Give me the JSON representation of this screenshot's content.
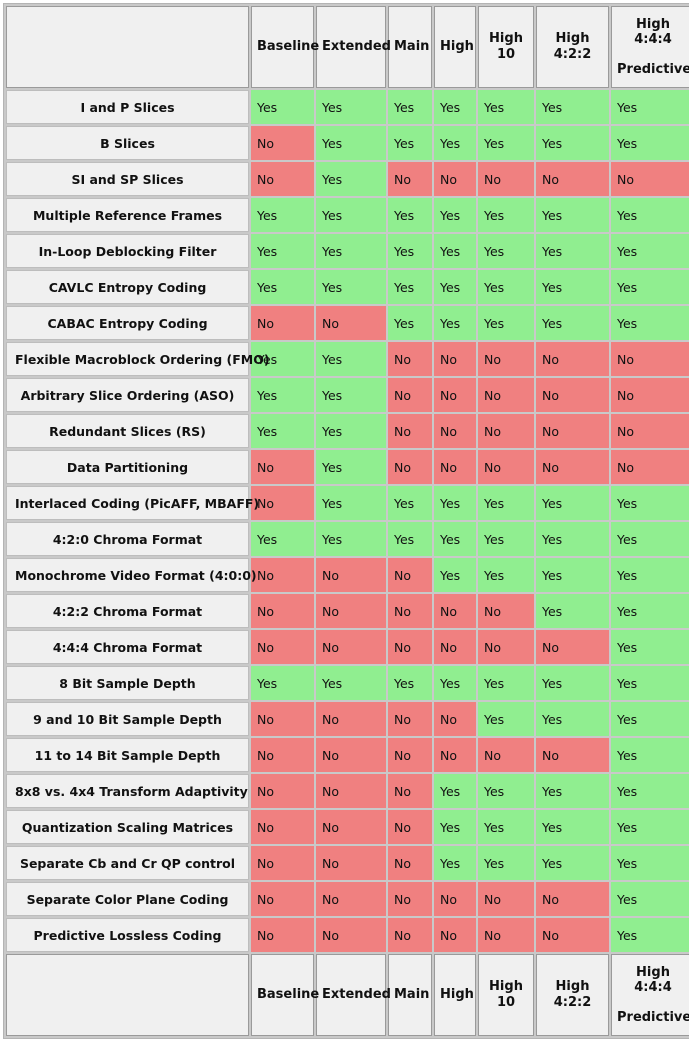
{
  "table": {
    "feature_column_header": "",
    "profiles": [
      {
        "id": "baseline",
        "label": "Baseline",
        "label_line2": ""
      },
      {
        "id": "extended",
        "label": "Extended",
        "label_line2": ""
      },
      {
        "id": "main",
        "label": "Main",
        "label_line2": ""
      },
      {
        "id": "high",
        "label": "High",
        "label_line2": ""
      },
      {
        "id": "high10",
        "label": "High 10",
        "label_line2": ""
      },
      {
        "id": "high422",
        "label": "High 4:2:2",
        "label_line2": ""
      },
      {
        "id": "high444",
        "label": "High 4:4:4",
        "label_line2": "Predictive"
      }
    ],
    "value_yes": "Yes",
    "value_no": "No",
    "colors": {
      "yes_background": "#90EE90",
      "no_background": "#F08080",
      "header_background": "#F0F0F0",
      "feature_background": "#F0F0F0",
      "grid_line": "#C9C9C9",
      "text": "#111111"
    },
    "rows": [
      {
        "feature": "I and P Slices",
        "values": [
          "Yes",
          "Yes",
          "Yes",
          "Yes",
          "Yes",
          "Yes",
          "Yes"
        ]
      },
      {
        "feature": "B Slices",
        "values": [
          "No",
          "Yes",
          "Yes",
          "Yes",
          "Yes",
          "Yes",
          "Yes"
        ]
      },
      {
        "feature": "SI and SP Slices",
        "values": [
          "No",
          "Yes",
          "No",
          "No",
          "No",
          "No",
          "No"
        ]
      },
      {
        "feature": "Multiple Reference Frames",
        "values": [
          "Yes",
          "Yes",
          "Yes",
          "Yes",
          "Yes",
          "Yes",
          "Yes"
        ]
      },
      {
        "feature": "In-Loop Deblocking Filter",
        "values": [
          "Yes",
          "Yes",
          "Yes",
          "Yes",
          "Yes",
          "Yes",
          "Yes"
        ]
      },
      {
        "feature": "CAVLC Entropy Coding",
        "values": [
          "Yes",
          "Yes",
          "Yes",
          "Yes",
          "Yes",
          "Yes",
          "Yes"
        ]
      },
      {
        "feature": "CABAC Entropy Coding",
        "values": [
          "No",
          "No",
          "Yes",
          "Yes",
          "Yes",
          "Yes",
          "Yes"
        ]
      },
      {
        "feature": "Flexible Macroblock Ordering (FMO)",
        "values": [
          "Yes",
          "Yes",
          "No",
          "No",
          "No",
          "No",
          "No"
        ]
      },
      {
        "feature": "Arbitrary Slice Ordering (ASO)",
        "values": [
          "Yes",
          "Yes",
          "No",
          "No",
          "No",
          "No",
          "No"
        ]
      },
      {
        "feature": "Redundant Slices (RS)",
        "values": [
          "Yes",
          "Yes",
          "No",
          "No",
          "No",
          "No",
          "No"
        ]
      },
      {
        "feature": "Data Partitioning",
        "values": [
          "No",
          "Yes",
          "No",
          "No",
          "No",
          "No",
          "No"
        ]
      },
      {
        "feature": "Interlaced Coding (PicAFF, MBAFF)",
        "values": [
          "No",
          "Yes",
          "Yes",
          "Yes",
          "Yes",
          "Yes",
          "Yes"
        ]
      },
      {
        "feature": "4:2:0 Chroma Format",
        "values": [
          "Yes",
          "Yes",
          "Yes",
          "Yes",
          "Yes",
          "Yes",
          "Yes"
        ]
      },
      {
        "feature": "Monochrome Video Format (4:0:0)",
        "values": [
          "No",
          "No",
          "No",
          "Yes",
          "Yes",
          "Yes",
          "Yes"
        ]
      },
      {
        "feature": "4:2:2 Chroma Format",
        "values": [
          "No",
          "No",
          "No",
          "No",
          "No",
          "Yes",
          "Yes"
        ]
      },
      {
        "feature": "4:4:4 Chroma Format",
        "values": [
          "No",
          "No",
          "No",
          "No",
          "No",
          "No",
          "Yes"
        ]
      },
      {
        "feature": "8 Bit Sample Depth",
        "values": [
          "Yes",
          "Yes",
          "Yes",
          "Yes",
          "Yes",
          "Yes",
          "Yes"
        ]
      },
      {
        "feature": "9 and 10 Bit Sample Depth",
        "values": [
          "No",
          "No",
          "No",
          "No",
          "Yes",
          "Yes",
          "Yes"
        ]
      },
      {
        "feature": "11 to 14 Bit Sample Depth",
        "values": [
          "No",
          "No",
          "No",
          "No",
          "No",
          "No",
          "Yes"
        ]
      },
      {
        "feature": "8x8 vs. 4x4 Transform Adaptivity",
        "values": [
          "No",
          "No",
          "No",
          "Yes",
          "Yes",
          "Yes",
          "Yes"
        ]
      },
      {
        "feature": "Quantization Scaling Matrices",
        "values": [
          "No",
          "No",
          "No",
          "Yes",
          "Yes",
          "Yes",
          "Yes"
        ]
      },
      {
        "feature": "Separate Cb and Cr QP control",
        "values": [
          "No",
          "No",
          "No",
          "Yes",
          "Yes",
          "Yes",
          "Yes"
        ]
      },
      {
        "feature": "Separate Color Plane Coding",
        "values": [
          "No",
          "No",
          "No",
          "No",
          "No",
          "No",
          "Yes"
        ]
      },
      {
        "feature": "Predictive Lossless Coding",
        "values": [
          "No",
          "No",
          "No",
          "No",
          "No",
          "No",
          "Yes"
        ]
      }
    ]
  }
}
